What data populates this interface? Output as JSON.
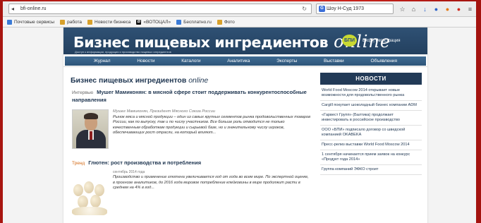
{
  "browser": {
    "url": "bfi-online.ru",
    "search_value": "Шоу Н-Суд 1973",
    "bookmarks": [
      {
        "label": "Почтовые сервисы"
      },
      {
        "label": "работа"
      },
      {
        "label": "Новости бизнеса"
      },
      {
        "label": "«ВОТОЦАЛ»"
      },
      {
        "label": "Бесплатно.ru"
      },
      {
        "label": "Фото"
      }
    ]
  },
  "header": {
    "logo_main": "Бизнес пищевых ингредиентов",
    "logo_online": "online",
    "tagline": "Доступ к информации, продукция и производство пищевых ингредиентов",
    "badge": "БПИ",
    "login": "Вход | Регистрация"
  },
  "nav": {
    "items": [
      "Журнал",
      "Новости",
      "Каталоги",
      "Аналитика",
      "Эксперты",
      "Выставки",
      "Объявления"
    ]
  },
  "main": {
    "title": "Бизнес пищевых ингредиентов",
    "title_suffix": "online",
    "article1": {
      "category": "Интервью",
      "headline": "Мушег Мамиконян: в мясной сфере стоит поддерживать конкурентоспособные направления",
      "meta": "Мушег Мамиконян, Президент Мясного Союза России",
      "body": "Рынок мяса и мясной продукции – один из самых крупных сегментов рынка продовольственных товаров России, как по выпуску, так и по числу участников. Все больше роль отводится не только качественным обработкам продукции и сырьевой базе, но и значительному числу игроков, обеспечивающих рост отрасли, на который влияют..."
    },
    "article2": {
      "category": "Тренд",
      "headline": "Глютен: рост производства и потребления",
      "date": "сентябрь 2014 года",
      "body": "Производство и применение глютена увеличивается год от года во всем мире. По экспертной оценке, в прогнозе аналитиков, до 2016 года мировое потребление клейковины в мире продолжит расти в среднем на 4% в год..."
    }
  },
  "sidebar": {
    "title": "НОВОСТИ",
    "news": [
      "World Food Moscow 2014 открывает новые возможности для продовольственного рынка",
      "Cargill покупает шоколадный бизнес компании ADM",
      "«Гарвест Групп» (Балтика) продолжает инвестировать в российское производство",
      "ООО «БПИ» подписало договор со шведской компанией OKABEKA",
      "Пресс-релиз выставки World Food Moscow 2014",
      "1 сентября начинается прием заявок на конкурс «Продукт года 2014»",
      "Группа компаний ЭФКО строит"
    ]
  },
  "colors": {
    "header_bg": "#23405f",
    "nav_bg": "#2e5579",
    "accent_orange": "#d36a16",
    "badge_green": "#c9d932",
    "frame_red": "#c6211a"
  },
  "icons": [
    "back-icon",
    "reload-icon",
    "star-icon",
    "home-icon",
    "download-icon",
    "menu-icon"
  ]
}
